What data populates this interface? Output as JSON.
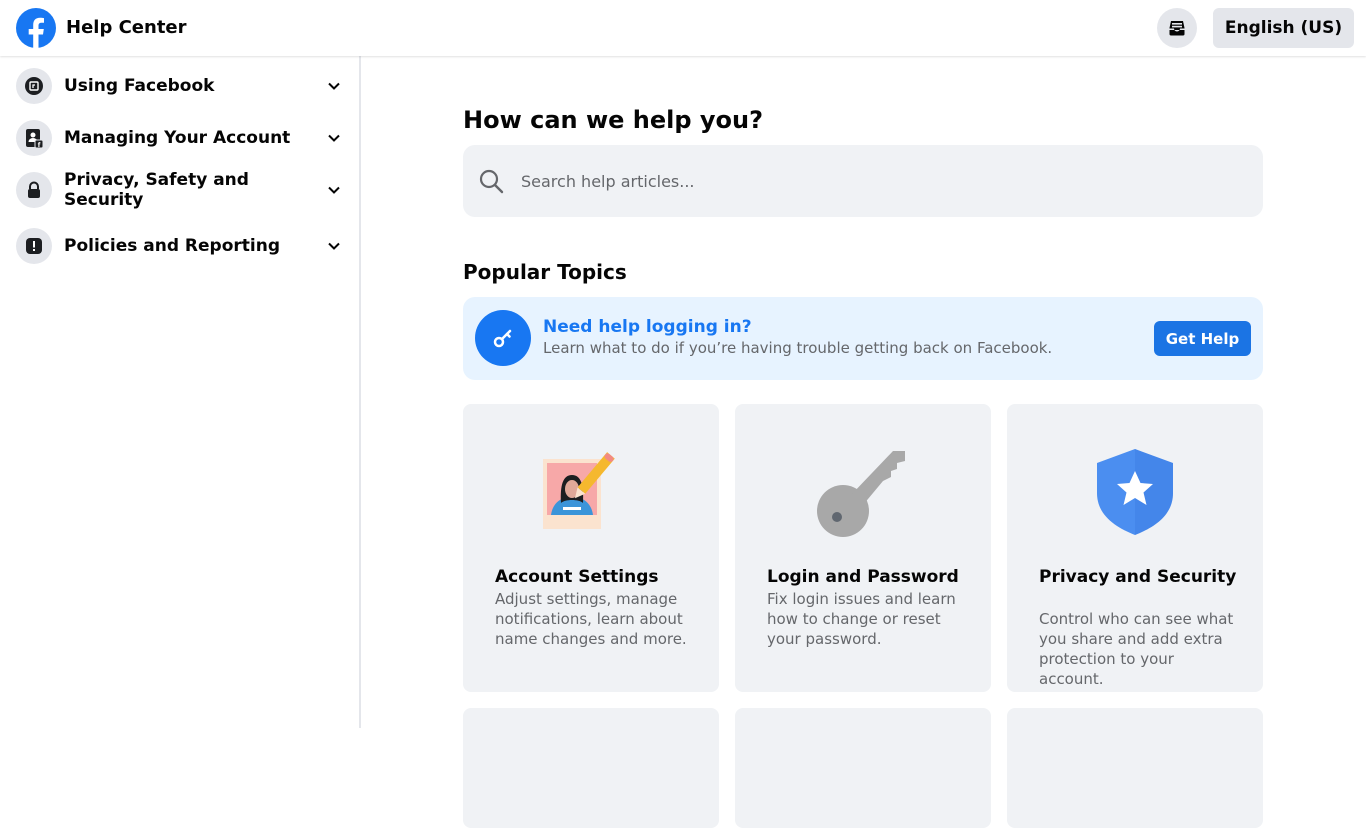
{
  "header": {
    "title": "Help Center",
    "logo_icon": "facebook-logo",
    "inbox_icon": "support-inbox-icon",
    "language_label": "English (US)"
  },
  "sidebar": {
    "items": [
      {
        "label": "Using Facebook",
        "icon": "facebook-page-icon"
      },
      {
        "label": "Managing Your Account",
        "icon": "account-card-icon"
      },
      {
        "label": "Privacy, Safety and Security",
        "icon": "lock-icon"
      },
      {
        "label": "Policies and Reporting",
        "icon": "alert-icon"
      }
    ]
  },
  "main": {
    "heading": "How can we help you?",
    "search": {
      "placeholder": "Search help articles...",
      "value": ""
    },
    "popular_heading": "Popular Topics",
    "banner": {
      "title": "Need help logging in?",
      "description": "Learn what to do if you’re having trouble getting back on Facebook.",
      "button_label": "Get Help",
      "icon": "key-icon"
    },
    "cards": [
      {
        "title": "Account Settings",
        "description": "Adjust settings, manage notifications, learn about name changes and more.",
        "illustration": "profile-photo-pencil-illustration"
      },
      {
        "title": "Login and Password",
        "description": "Fix login issues and learn how to change or reset your password.",
        "illustration": "key-illustration"
      },
      {
        "title": "Privacy and Security",
        "description": "Control who can see what you share and add extra protection to your account.",
        "illustration": "shield-star-illustration"
      }
    ]
  },
  "colors": {
    "brand": "#1877f2",
    "surface": "#f0f2f5",
    "banner_bg": "#e7f3ff",
    "muted_text": "#65676b"
  }
}
